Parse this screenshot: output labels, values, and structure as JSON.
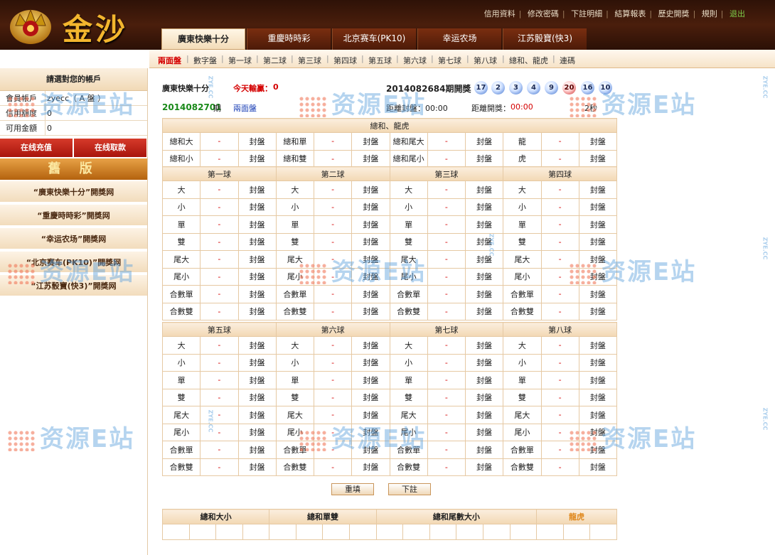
{
  "brand": {
    "name": "金沙"
  },
  "toplinks": [
    "信用資料",
    "修改密碼",
    "下註明細",
    "結算報表",
    "歷史開獎",
    "規則"
  ],
  "logout": "退出",
  "tabs": [
    "廣東快樂十分",
    "重慶時時彩",
    "北京赛车(PK10)",
    "幸运农场",
    "江苏骰寶(快3)"
  ],
  "subnav": [
    "兩面盤",
    "數字盤",
    "第一球",
    "第二球",
    "第三球",
    "第四球",
    "第五球",
    "第六球",
    "第七球",
    "第八球",
    "總和、龍虎",
    "連碼"
  ],
  "account": {
    "title": "請選對您的帳戶",
    "rows": [
      {
        "k": "會員帳戶",
        "v": "zyecc（ A 盤 ）"
      },
      {
        "k": "信用額度",
        "v": "0"
      },
      {
        "k": "可用金額",
        "v": "0"
      }
    ]
  },
  "buttons": {
    "recharge": "在线充值",
    "withdraw": "在线取款",
    "oldver": "舊 版",
    "reset": "重填",
    "submit": "下註"
  },
  "sidelinks": [
    "“廣東快樂十分”開獎网",
    "“重慶時時彩”開獎网",
    "“幸运农场”開獎网",
    "“北京赛车(PK10)”開獎网",
    "“江苏骰寶(快3)”開獎网"
  ],
  "info": {
    "game": "廣東快樂十分",
    "today_label": "今天輸贏：",
    "today_val": "0",
    "draw_label": "2014082684期開獎",
    "period": "2014082701",
    "period_suffix": "期",
    "mode": "兩面盤",
    "close_label": "距離封盤：00:00",
    "open_label": "距離開獎：",
    "open_val": "00:00",
    "refresh": "2秒"
  },
  "balls": [
    "17",
    "2",
    "3",
    "4",
    "9",
    "20",
    "16",
    "10"
  ],
  "ball_colors": [
    "blue",
    "blue",
    "blue",
    "blue",
    "blue",
    "red",
    "blue",
    "blue"
  ],
  "sum_section": {
    "title": "總和、龍虎",
    "rows": [
      [
        "總和大",
        "-",
        "封盤",
        "總和單",
        "-",
        "封盤",
        "總和尾大",
        "-",
        "封盤",
        "龍",
        "-",
        "封盤"
      ],
      [
        "總和小",
        "-",
        "封盤",
        "總和雙",
        "-",
        "封盤",
        "總和尾小",
        "-",
        "封盤",
        "虎",
        "-",
        "封盤"
      ]
    ]
  },
  "group1": {
    "heads": [
      "第一球",
      "第二球",
      "第三球",
      "第四球"
    ]
  },
  "group2": {
    "heads": [
      "第五球",
      "第六球",
      "第七球",
      "第八球"
    ]
  },
  "ball_items": [
    "大",
    "小",
    "單",
    "雙",
    "尾大",
    "尾小",
    "合數單",
    "合數雙"
  ],
  "odds": "-",
  "closed": "封盤",
  "bottom": {
    "heads": [
      "總和大小",
      "總和單雙",
      "總和尾數大小",
      "龍虎"
    ]
  },
  "watermark": {
    "text": "资源E站",
    "sub": "ZYE.CC"
  }
}
